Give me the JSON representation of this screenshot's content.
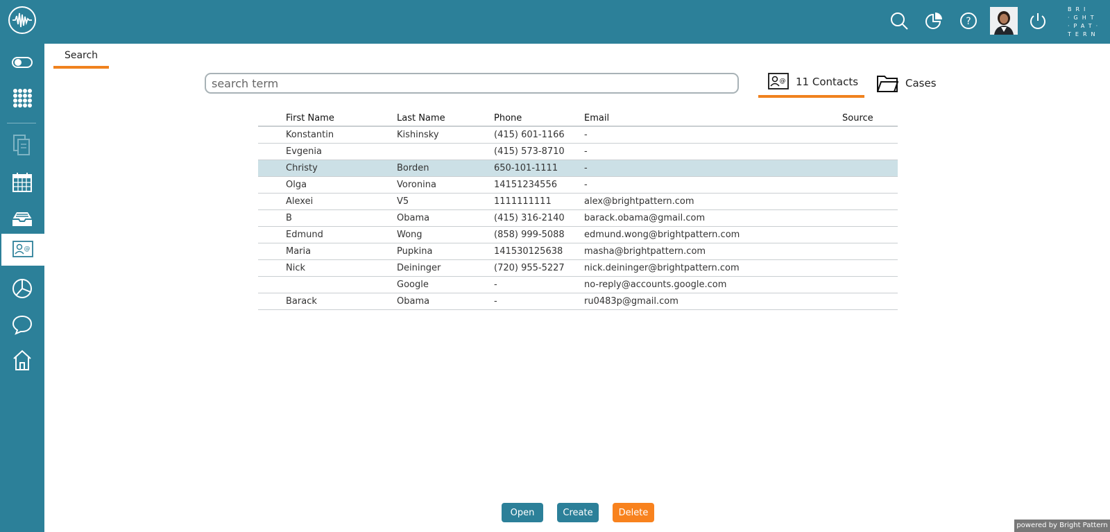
{
  "header": {
    "brand_letters": "BRIGHTPATTERN",
    "top_icons": [
      "search-icon",
      "stats-icon",
      "help-icon",
      "logout-icon"
    ]
  },
  "sidebar": {
    "items": [
      {
        "icon": "toggle-icon"
      },
      {
        "icon": "dialpad-icon"
      },
      {
        "icon": "documents-icon"
      },
      {
        "icon": "calendar-icon"
      },
      {
        "icon": "inbox-icon"
      },
      {
        "icon": "contacts-icon",
        "active": true
      },
      {
        "icon": "pie-chart-icon"
      },
      {
        "icon": "chat-icon"
      },
      {
        "icon": "home-icon"
      }
    ]
  },
  "tabs": {
    "search": "Search"
  },
  "search": {
    "placeholder": "search term",
    "value": ""
  },
  "result_tabs": {
    "contacts": "11 Contacts",
    "cases": "Cases"
  },
  "table": {
    "headers": [
      "First Name",
      "Last Name",
      "Phone",
      "Email",
      "Source"
    ],
    "rows": [
      [
        "Konstantin",
        "Kishinsky",
        "(415) 601-1166",
        "-",
        ""
      ],
      [
        "Evgenia",
        "",
        "(415) 573-8710",
        "-",
        ""
      ],
      [
        "Christy",
        "Borden",
        "650-101-1111",
        "-",
        ""
      ],
      [
        "Olga",
        "Voronina",
        "14151234556",
        "-",
        ""
      ],
      [
        "Alexei",
        "V5",
        "1111111111",
        "alex@brightpattern.com",
        ""
      ],
      [
        "B",
        "Obama",
        "(415) 316-2140",
        "barack.obama@gmail.com",
        ""
      ],
      [
        "Edmund",
        "Wong",
        "(858) 999-5088",
        "edmund.wong@brightpattern.com",
        ""
      ],
      [
        "Maria",
        "Pupkina",
        "141530125638",
        "masha@brightpattern.com",
        ""
      ],
      [
        "Nick",
        "Deininger",
        "(720) 955-5227",
        "nick.deininger@brightpattern.com",
        ""
      ],
      [
        "",
        "Google",
        "-",
        "no-reply@accounts.google.com",
        ""
      ],
      [
        "Barack",
        "Obama",
        "-",
        "ru0483p@gmail.com",
        ""
      ]
    ],
    "selected_row": 2
  },
  "actions": {
    "open": "Open",
    "create": "Create",
    "delete": "Delete"
  },
  "footer": {
    "powered_by": "powered by Bright Pattern"
  },
  "colors": {
    "brand": "#2c8099",
    "accent": "#f0821e",
    "selected_row": "#cce0e6"
  }
}
